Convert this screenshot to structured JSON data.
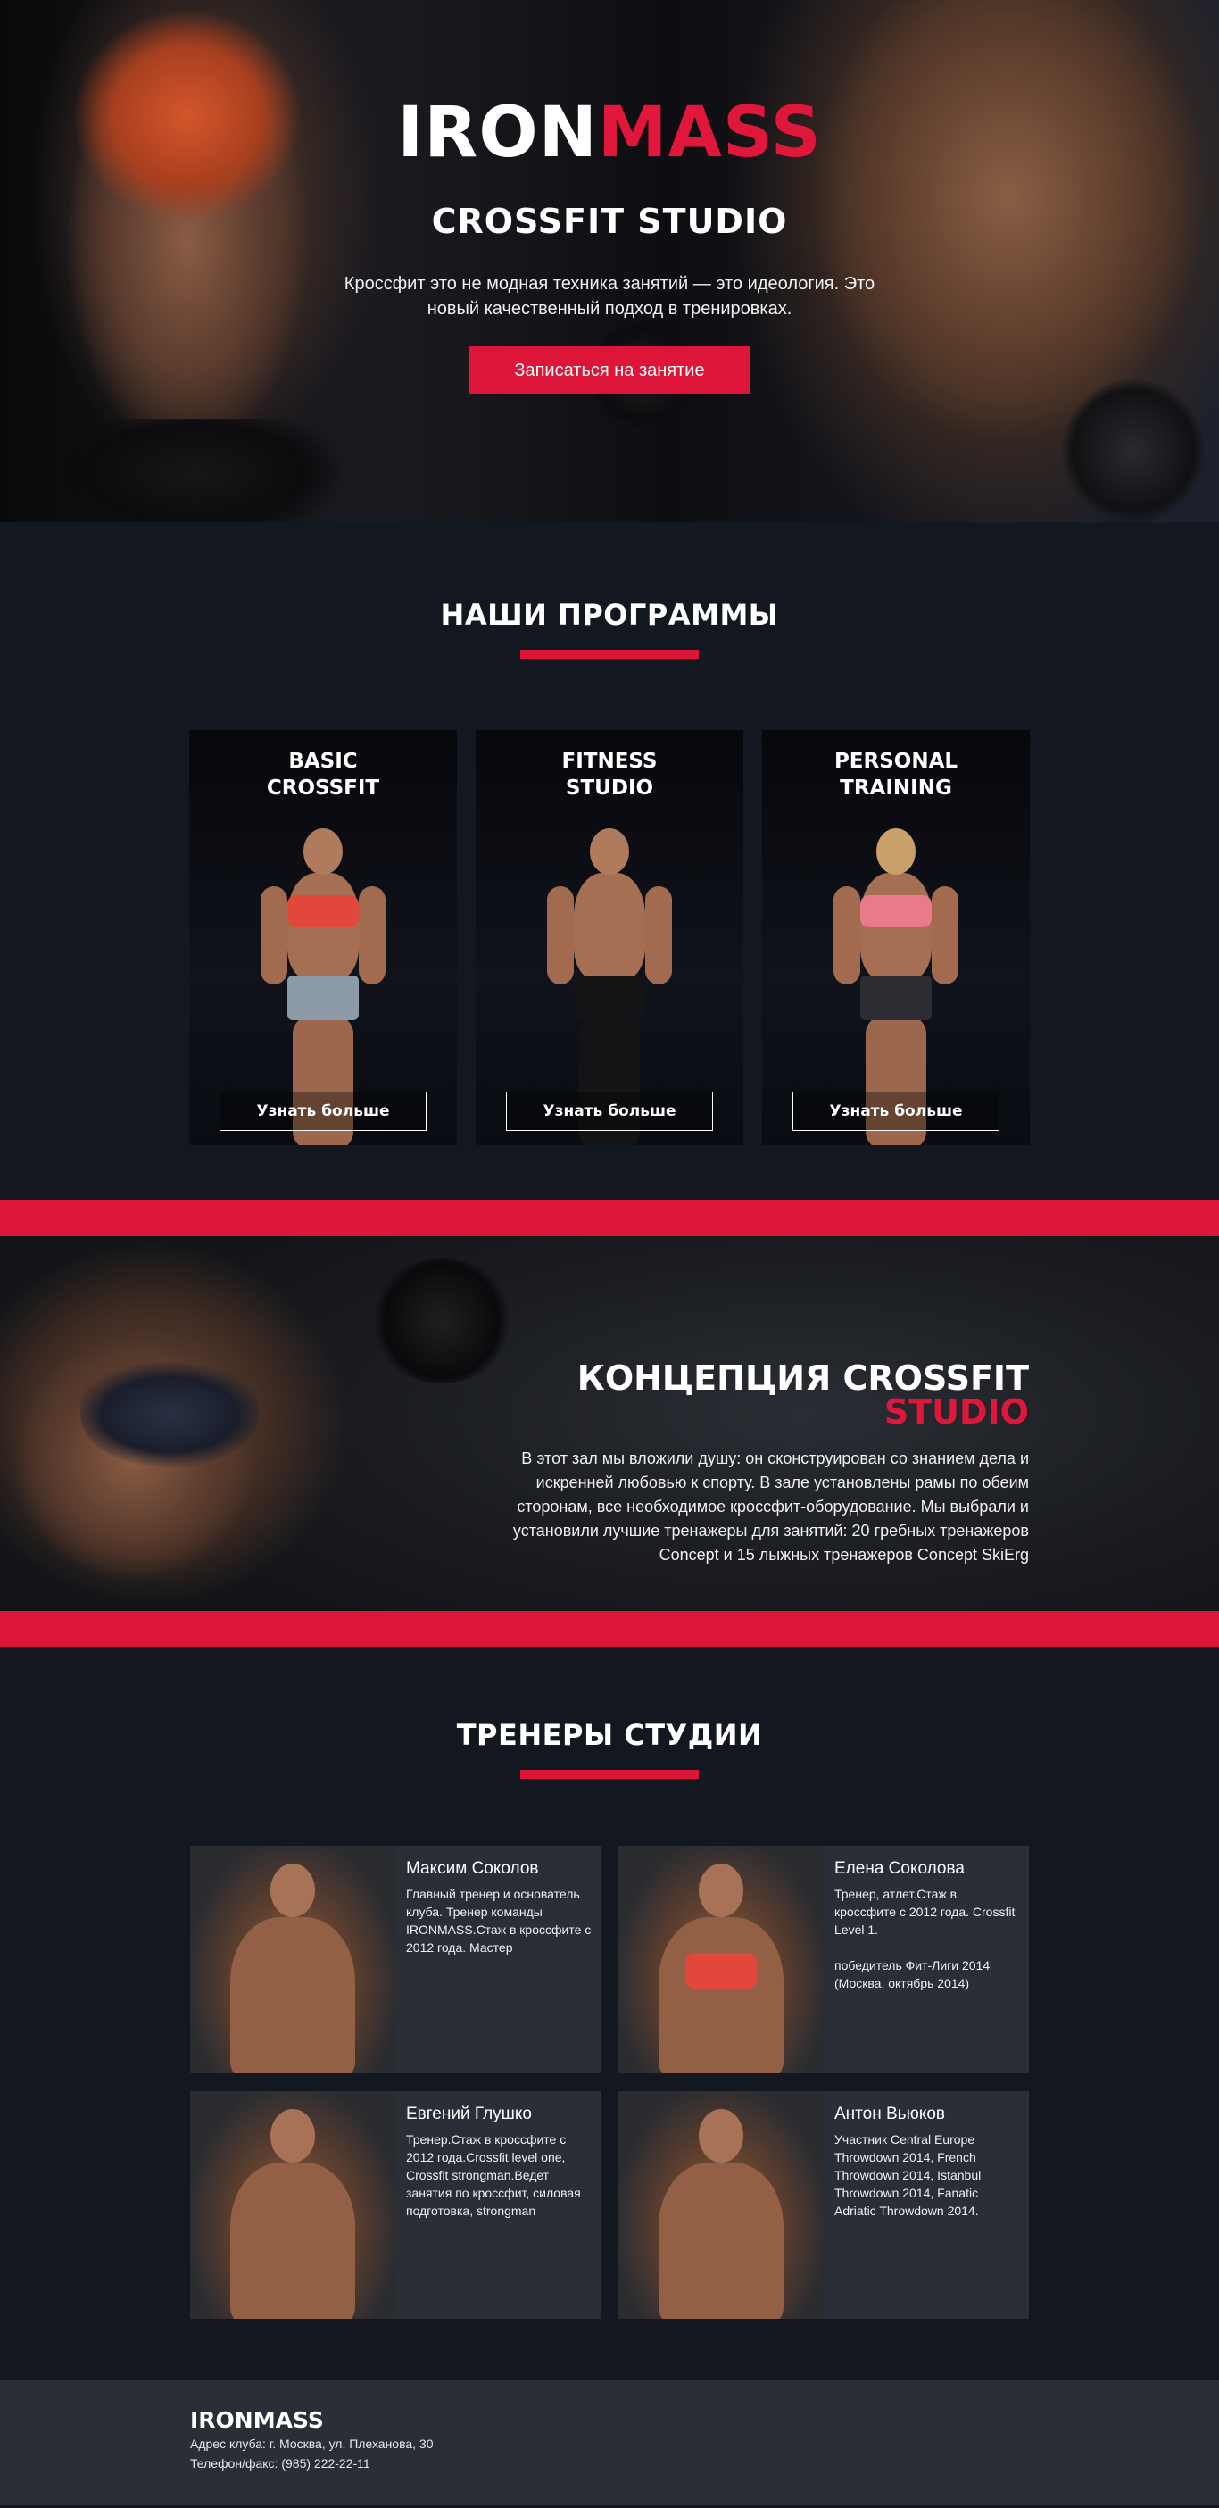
{
  "hero": {
    "logo_part1": "IRON",
    "logo_part2": "MASS",
    "subtitle": "CROSSFIT STUDIO",
    "text": "Кроссфит это не модная техника занятий — это идеология. Это новый качественный подход в тренировках.",
    "cta_label": "Записаться на занятие"
  },
  "programs": {
    "title": "НАШИ ПРОГРАММЫ",
    "cards": [
      {
        "title": "BASIC\nCROSSFIT",
        "button": "Узнать больше"
      },
      {
        "title": "FITNESS\nSTUDIO",
        "button": "Узнать больше"
      },
      {
        "title": "PERSONAL\nTRAINING",
        "button": "Узнать больше"
      }
    ]
  },
  "concept": {
    "title_part1": "КОНЦЕПЦИЯ CROSSFIT ",
    "title_part2": "STUDIO",
    "text": "В этот зал мы вложили душу: он сконструирован со знанием дела и искренней любовью к спорту. В зале установлены рамы по обеим сторонам, все необходимое кроссфит-оборудование. Мы выбрали и установили лучшие тренажеры для занятий: 20 гребных тренажеров Concept и 15 лыжных тренажеров Concept SkiErg"
  },
  "trainers": {
    "title": "ТРЕНЕРЫ СТУДИИ",
    "items": [
      {
        "name": "Максим Соколов",
        "desc": "Главный тренер и основатель клуба. Тренер команды IRONMASS.Стаж в кроссфите с 2012 года. Мастер"
      },
      {
        "name": "Елена Соколова",
        "desc": "Тренер, атлет.Стаж в кроссфите с 2012 года. Crossfit Level 1.\n\nпобедитель Фит-Лиги 2014 (Москва, октябрь 2014)"
      },
      {
        "name": "Евгений Глушко",
        "desc": "Тренер.Стаж в кроссфите с 2012 года.Crossfit level one, Crossfit strongman.Ведет занятия по кроссфит, силовая подготовка, strongman"
      },
      {
        "name": "Антон Вьюков",
        "desc": "Участник Central Europe Throwdown 2014, French Throwdown 2014, Istanbul Throwdown 2014, Fanatic Adriatic Throwdown 2014."
      }
    ]
  },
  "footer": {
    "logo": "IRONMASS",
    "address": "Адрес клуба: г. Москва, ул. Плеханова, 30",
    "phone": "Телефон/факс: (985) 222-22-11"
  },
  "colors": {
    "accent": "#dc1539",
    "background": "#131820",
    "panel": "#2a2e36"
  }
}
